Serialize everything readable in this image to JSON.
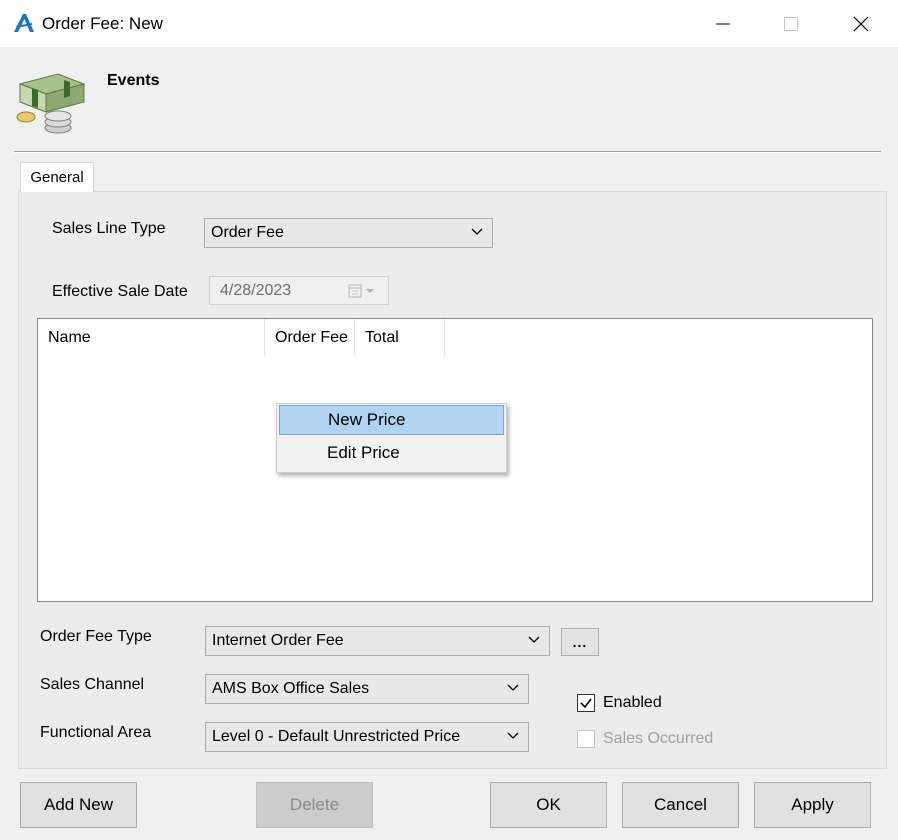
{
  "window": {
    "title": "Order Fee: New"
  },
  "header": {
    "section_title": "Events"
  },
  "tabs": [
    {
      "label": "General",
      "active": true
    }
  ],
  "form": {
    "sales_line_type": {
      "label": "Sales Line Type",
      "value": "Order Fee"
    },
    "effective_sale_date": {
      "label": "Effective Sale Date",
      "value": "4/28/2023"
    },
    "order_fee_type": {
      "label": "Order Fee Type",
      "value": "Internet Order Fee",
      "browse_label": "..."
    },
    "sales_channel": {
      "label": "Sales Channel",
      "value": "AMS Box Office Sales"
    },
    "functional_area": {
      "label": "Functional Area",
      "value": "Level 0 - Default Unrestricted Price"
    },
    "enabled": {
      "label": "Enabled",
      "checked": true
    },
    "sales_occurred": {
      "label": "Sales Occurred",
      "checked": false,
      "disabled": true
    }
  },
  "grid": {
    "columns": [
      "Name",
      "Order Fee",
      "Total"
    ],
    "rows": []
  },
  "context_menu": {
    "items": [
      {
        "label": "New Price",
        "highlighted": true
      },
      {
        "label": "Edit Price",
        "highlighted": false
      }
    ]
  },
  "buttons": {
    "add_new": "Add New",
    "delete": "Delete",
    "ok": "OK",
    "cancel": "Cancel",
    "apply": "Apply"
  },
  "colors": {
    "selection": "#b0d4f1",
    "app_icon": "#1e73be"
  }
}
